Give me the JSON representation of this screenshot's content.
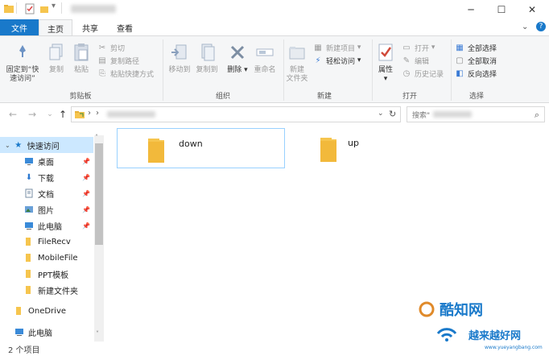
{
  "ribbon_tabs": {
    "file": "文件",
    "home": "主页",
    "share": "共享",
    "view": "查看"
  },
  "clipboard": {
    "pin": "固定到“快速访问”",
    "copy": "复制",
    "paste": "粘贴",
    "cut": "剪切",
    "copy_path": "复制路径",
    "paste_shortcut": "粘贴快捷方式",
    "label": "剪贴板"
  },
  "organize": {
    "move_to": "移动到",
    "copy_to": "复制到",
    "delete": "删除",
    "rename": "重命名",
    "label": "组织"
  },
  "new_group": {
    "new_folder": "新建\n文件夹",
    "new_item": "新建项目",
    "easy_access": "轻松访问",
    "label": "新建"
  },
  "open_group": {
    "properties": "属性",
    "open": "打开",
    "edit": "编辑",
    "history": "历史记录",
    "label": "打开"
  },
  "select_group": {
    "select_all": "全部选择",
    "select_none": "全部取消",
    "invert": "反向选择",
    "label": "选择"
  },
  "search": {
    "placeholder": "搜索\""
  },
  "nav": {
    "quick_access": "快速访问",
    "items": [
      {
        "label": "桌面",
        "icon": "desktop-icon",
        "pinned": true
      },
      {
        "label": "下载",
        "icon": "download-icon",
        "pinned": true
      },
      {
        "label": "文档",
        "icon": "document-icon",
        "pinned": true
      },
      {
        "label": "图片",
        "icon": "pictures-icon",
        "pinned": true
      },
      {
        "label": "此电脑",
        "icon": "computer-icon",
        "pinned": true
      },
      {
        "label": "FileRecv",
        "icon": "folder-icon",
        "pinned": false
      },
      {
        "label": "MobileFile",
        "icon": "folder-icon",
        "pinned": false
      },
      {
        "label": "PPT模板",
        "icon": "folder-icon",
        "pinned": false
      },
      {
        "label": "新建文件夹",
        "icon": "folder-icon",
        "pinned": false
      }
    ],
    "onedrive": "OneDrive",
    "this_pc": "此电脑"
  },
  "folders": [
    {
      "name": "down"
    },
    {
      "name": "up"
    }
  ],
  "status": {
    "count": "2 个项目"
  },
  "watermark": {
    "brand1": "酷知网",
    "brand2": "越来越好网",
    "url": "www.yueyangbang.com"
  },
  "colors": {
    "accent": "#1979ca",
    "folder": "#f6c54e",
    "selection": "#cce8ff"
  }
}
